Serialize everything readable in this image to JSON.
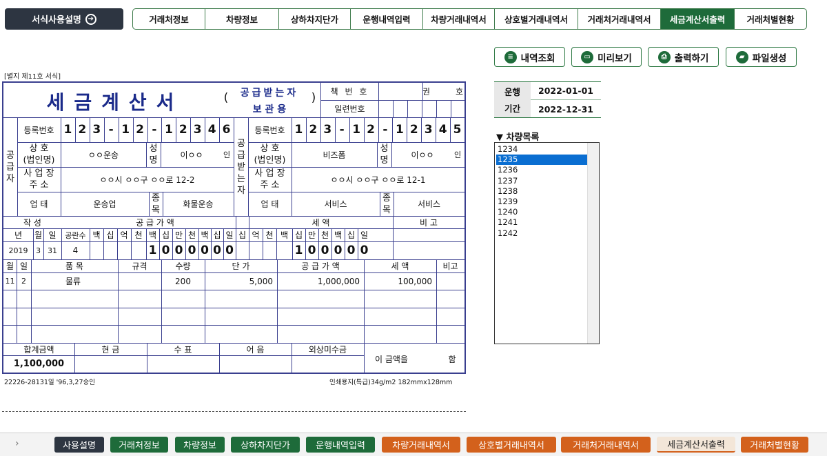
{
  "top": {
    "guide_label": "서식사용설명",
    "guide_icon": "arrow-right-circle-icon",
    "tabs": [
      "거래처정보",
      "차량정보",
      "상하차지단가",
      "운행내역입력",
      "차량거래내역서",
      "상호별거래내역서",
      "거래처거래내역서",
      "세금계산서출력",
      "거래처별현황"
    ],
    "active_tab": "세금계산서출력",
    "accent": "#1e6b3a"
  },
  "actions": [
    {
      "label": "내역조회",
      "icon": "list-icon"
    },
    {
      "label": "미리보기",
      "icon": "monitor-icon"
    },
    {
      "label": "출력하기",
      "icon": "printer-icon"
    },
    {
      "label": "파일생성",
      "icon": "folder-icon"
    }
  ],
  "period": {
    "label1": "운행",
    "label2": "기간",
    "start": "2022-01-01",
    "end": "2022-12-31"
  },
  "vehicles": {
    "title": "▼ 차량목록",
    "items": [
      "1234",
      "1235",
      "1236",
      "1237",
      "1238",
      "1239",
      "1240",
      "1241",
      "1242"
    ],
    "selected": "1235"
  },
  "invoice": {
    "form_note": "[별지 제11호 서식]",
    "title": "세금계산서",
    "paren_open": "(",
    "paren_close": ")",
    "copy_type_1": "공급받는자",
    "copy_type_2": "보   관   용",
    "book_no_label": "책 번 호",
    "book_unit": "권",
    "book_unit2": "호",
    "serial_label": "일련번호",
    "supplier_label": "공\n급\n자",
    "receiver_label": "공\n급\n받\n는\n자",
    "reg_no_label": "등록번호",
    "name_label_1": "상   호",
    "name_label_2": "(법인명)",
    "rep_label_1": "성",
    "rep_label_2": "명",
    "addr_label_1": "사 업 장",
    "addr_label_2": "주   소",
    "biz_label": "업   태",
    "item_label_1": "종",
    "item_label_2": "목",
    "seal": "인",
    "supplier": {
      "reg_no": [
        "1",
        "2",
        "3",
        "-",
        "1",
        "2",
        "-",
        "1",
        "2",
        "3",
        "4",
        "6"
      ],
      "name": "ㅇㅇ운송",
      "rep": "이ㅇㅇ",
      "addr": "ㅇㅇ시 ㅇㅇ구 ㅇㅇ로 12-2",
      "biz_type": "운송업",
      "biz_item": "화물운송"
    },
    "receiver": {
      "reg_no": [
        "1",
        "2",
        "3",
        "-",
        "1",
        "2",
        "-",
        "1",
        "2",
        "3",
        "4",
        "5"
      ],
      "name": "비즈폼",
      "rep": "이ㅇㅇ",
      "addr": "ㅇㅇ시 ㅇㅇ구 ㅇㅇ로 12-1",
      "biz_type": "서비스",
      "biz_item": "서비스"
    },
    "issue_label": "작   성",
    "supply_amount_label": "공   급   가   액",
    "tax_label": "세         액",
    "remark_label": "비   고",
    "date_heads": [
      "년",
      "월",
      "일"
    ],
    "blank_head": "공란수",
    "supply_digit_heads": [
      "백",
      "십",
      "억",
      "천",
      "백",
      "십",
      "만",
      "천",
      "백",
      "십",
      "일"
    ],
    "tax_digit_heads": [
      "십",
      "억",
      "천",
      "백",
      "십",
      "만",
      "천",
      "백",
      "십",
      "일"
    ],
    "issue_year": "2019",
    "issue_month": "3",
    "issue_day": "31",
    "blank_count": "4",
    "supply_digits": [
      "",
      "",
      "",
      "",
      "1",
      "0",
      "0",
      "0",
      "0",
      "0",
      "0"
    ],
    "tax_digits": [
      "",
      "",
      "",
      "",
      "1",
      "0",
      "0",
      "0",
      "0",
      "0"
    ],
    "item_heads": {
      "month": "월",
      "day": "일",
      "item": "품     목",
      "spec": "규격",
      "qty": "수량",
      "unit_price": "단     가",
      "supply": "공 급 가 액",
      "tax": "세     액",
      "remark": "비고"
    },
    "lines": [
      {
        "month": "11",
        "day": "2",
        "item": "물류",
        "spec": "",
        "qty": "200",
        "unit_price": "5,000",
        "supply": "1,000,000",
        "tax": "100,000",
        "remark": ""
      }
    ],
    "total_label": "합계금액",
    "cash_label": "현   금",
    "check_label": "수   표",
    "note_label": "어   음",
    "credit_label": "외상미수금",
    "total": "1,100,000",
    "receipt_1": "이 금액을",
    "receipt_2": "함",
    "footer_left": "22226-28131일 '96,3,27승인",
    "footer_right": "인쇄용지(특급)34g/m2 182mmx128mm"
  },
  "sheet_tabs": [
    {
      "label": "사용설명",
      "color": "#2d3541"
    },
    {
      "label": "거래처정보",
      "color": "#1e6b3a"
    },
    {
      "label": "차량정보",
      "color": "#1e6b3a"
    },
    {
      "label": "상하차지단가",
      "color": "#1e6b3a"
    },
    {
      "label": "운행내역입력",
      "color": "#1e6b3a"
    },
    {
      "label": "차량거래내역서",
      "color": "#d3611c"
    },
    {
      "label": "상호별거래내역서",
      "color": "#d3611c"
    },
    {
      "label": "거래처거래내역서",
      "color": "#d3611c"
    },
    {
      "label": "세금계산서출력",
      "color": "#f3e6d8"
    },
    {
      "label": "거래처별현황",
      "color": "#d3611c"
    }
  ],
  "sheet_arrow": "›"
}
